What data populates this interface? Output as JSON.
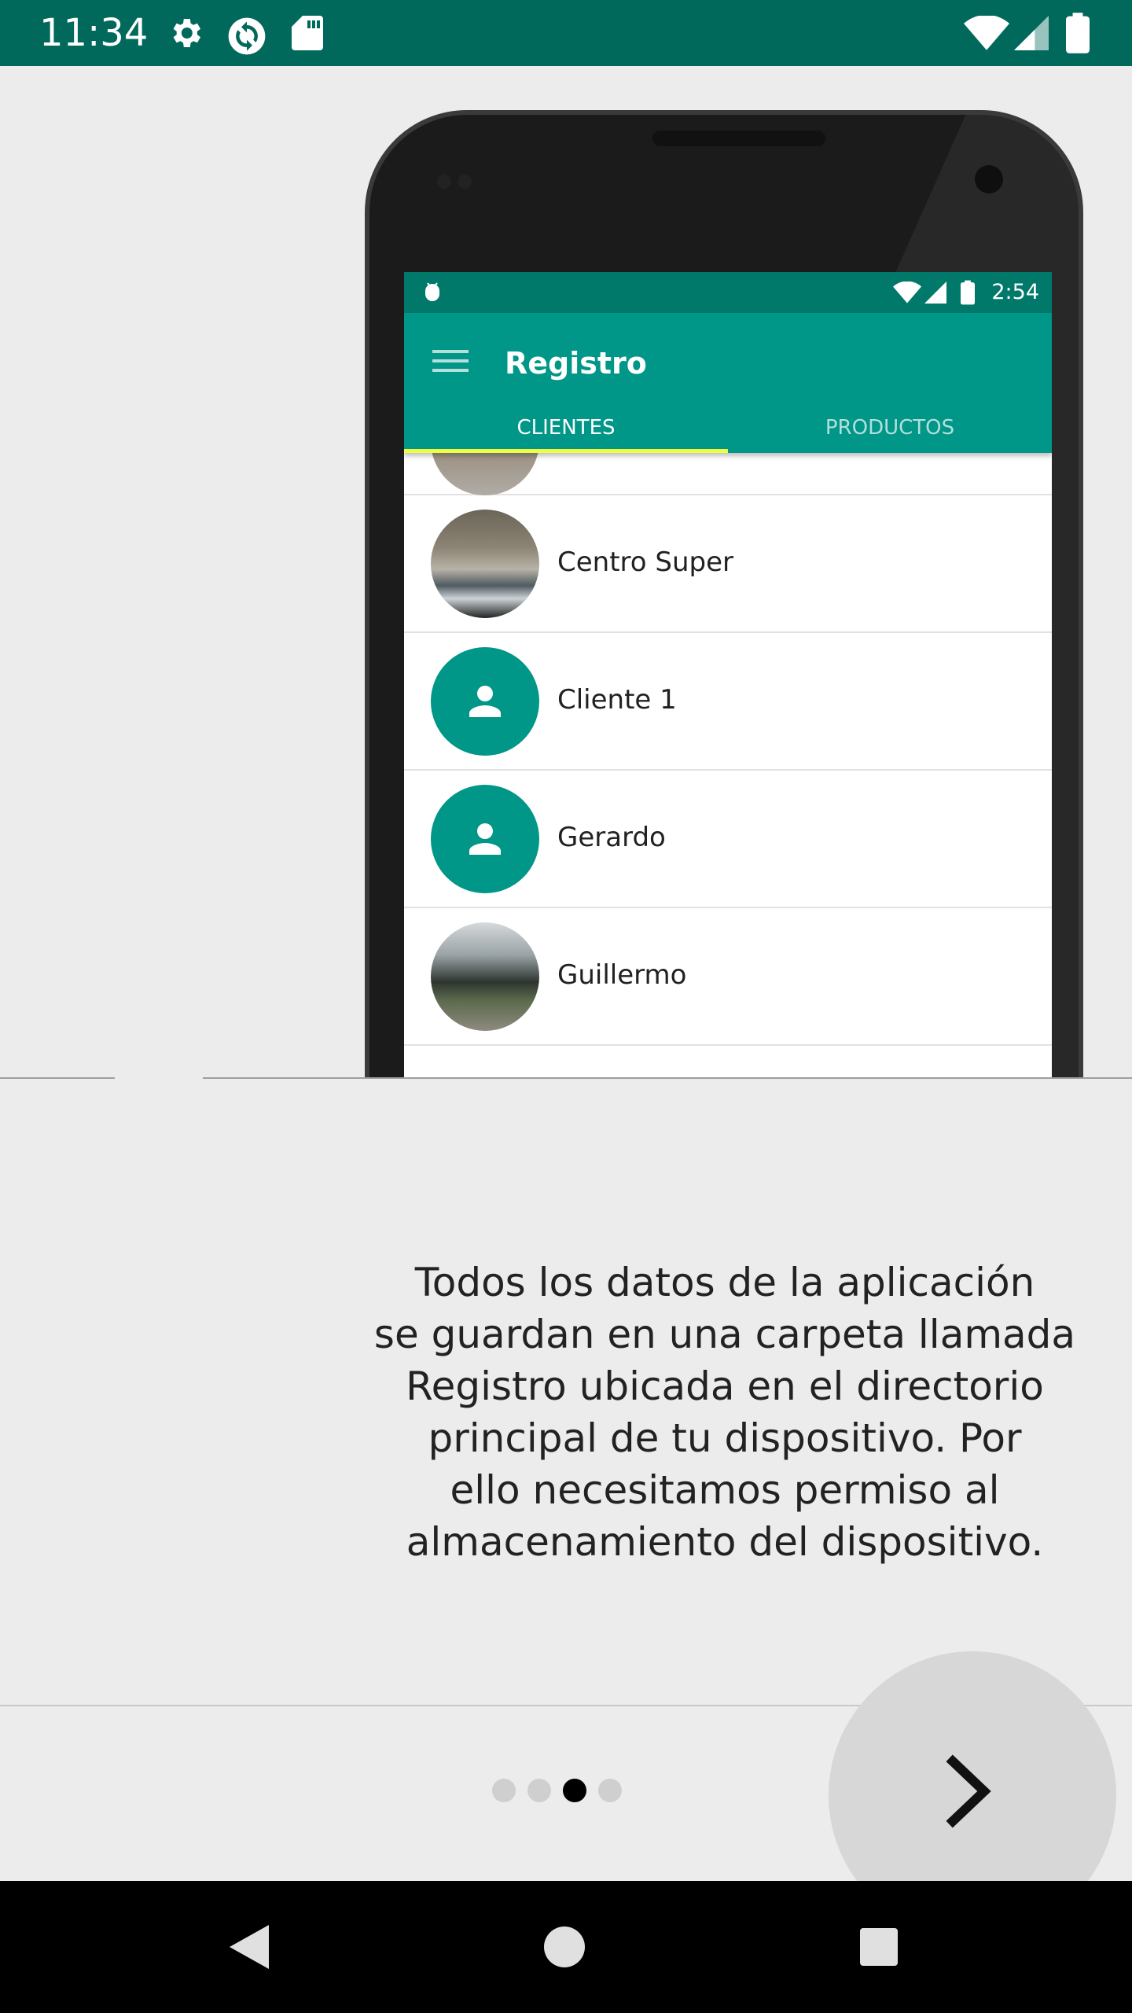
{
  "status_bar": {
    "time": "11:34",
    "icons": [
      "settings-icon",
      "sync-icon",
      "sd-card-icon",
      "wifi-icon",
      "signal-icon",
      "battery-icon"
    ],
    "background": "#00695c"
  },
  "phone_screen": {
    "status_time": "2:54",
    "app_title": "Registro",
    "tabs": [
      {
        "label": "CLIENTES",
        "active": true
      },
      {
        "label": "PRODUCTOS",
        "active": false
      }
    ],
    "clients": [
      {
        "name": "Centro Super",
        "avatar": "photo"
      },
      {
        "name": "Cliente 1",
        "avatar": "person-icon"
      },
      {
        "name": "Gerardo",
        "avatar": "person-icon"
      },
      {
        "name": "Guillermo",
        "avatar": "photo"
      }
    ],
    "colors": {
      "primary": "#009688",
      "primary_dark": "#00796b",
      "tab_indicator": "#eeff41"
    }
  },
  "intro": {
    "description_lines": [
      "Todos los datos de la aplicación",
      "se guardan en una carpeta llamada",
      "Registro ubicada en el directorio",
      "principal de tu dispositivo. Por",
      "ello necesitamos permiso al",
      "almacenamiento del dispositivo."
    ]
  },
  "pager": {
    "total_pages": 4,
    "current_page": 3,
    "next_icon": "chevron-right-icon"
  },
  "nav_bar": {
    "buttons": [
      "back-icon",
      "home-icon",
      "recents-icon"
    ]
  }
}
